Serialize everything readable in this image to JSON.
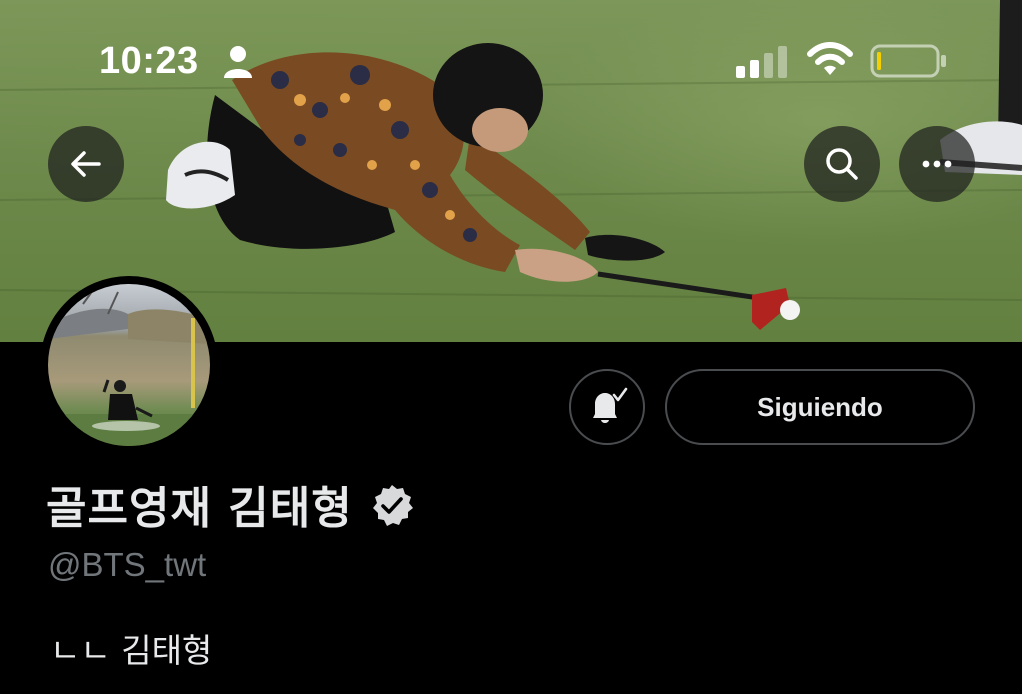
{
  "status_bar": {
    "time": "10:23",
    "icons": [
      "person-icon",
      "cellular-signal-icon",
      "wifi-icon",
      "battery-icon"
    ],
    "battery_color": "#f5d000"
  },
  "header": {
    "back_icon": "arrow-left-icon",
    "search_icon": "search-icon",
    "more_icon": "ellipsis-icon"
  },
  "profile": {
    "notification_icon": "bell-check-icon",
    "follow_label": "Siguiendo",
    "display_name": "골프영재 김태형",
    "verified_icon": "verified-badge-icon",
    "handle": "@BTS_twt",
    "bio": "ㄴㄴ 김태형"
  },
  "colors": {
    "background": "#000000",
    "primary_text": "#e7e9ea",
    "secondary_text": "#71767b",
    "border": "#4a4d50"
  }
}
